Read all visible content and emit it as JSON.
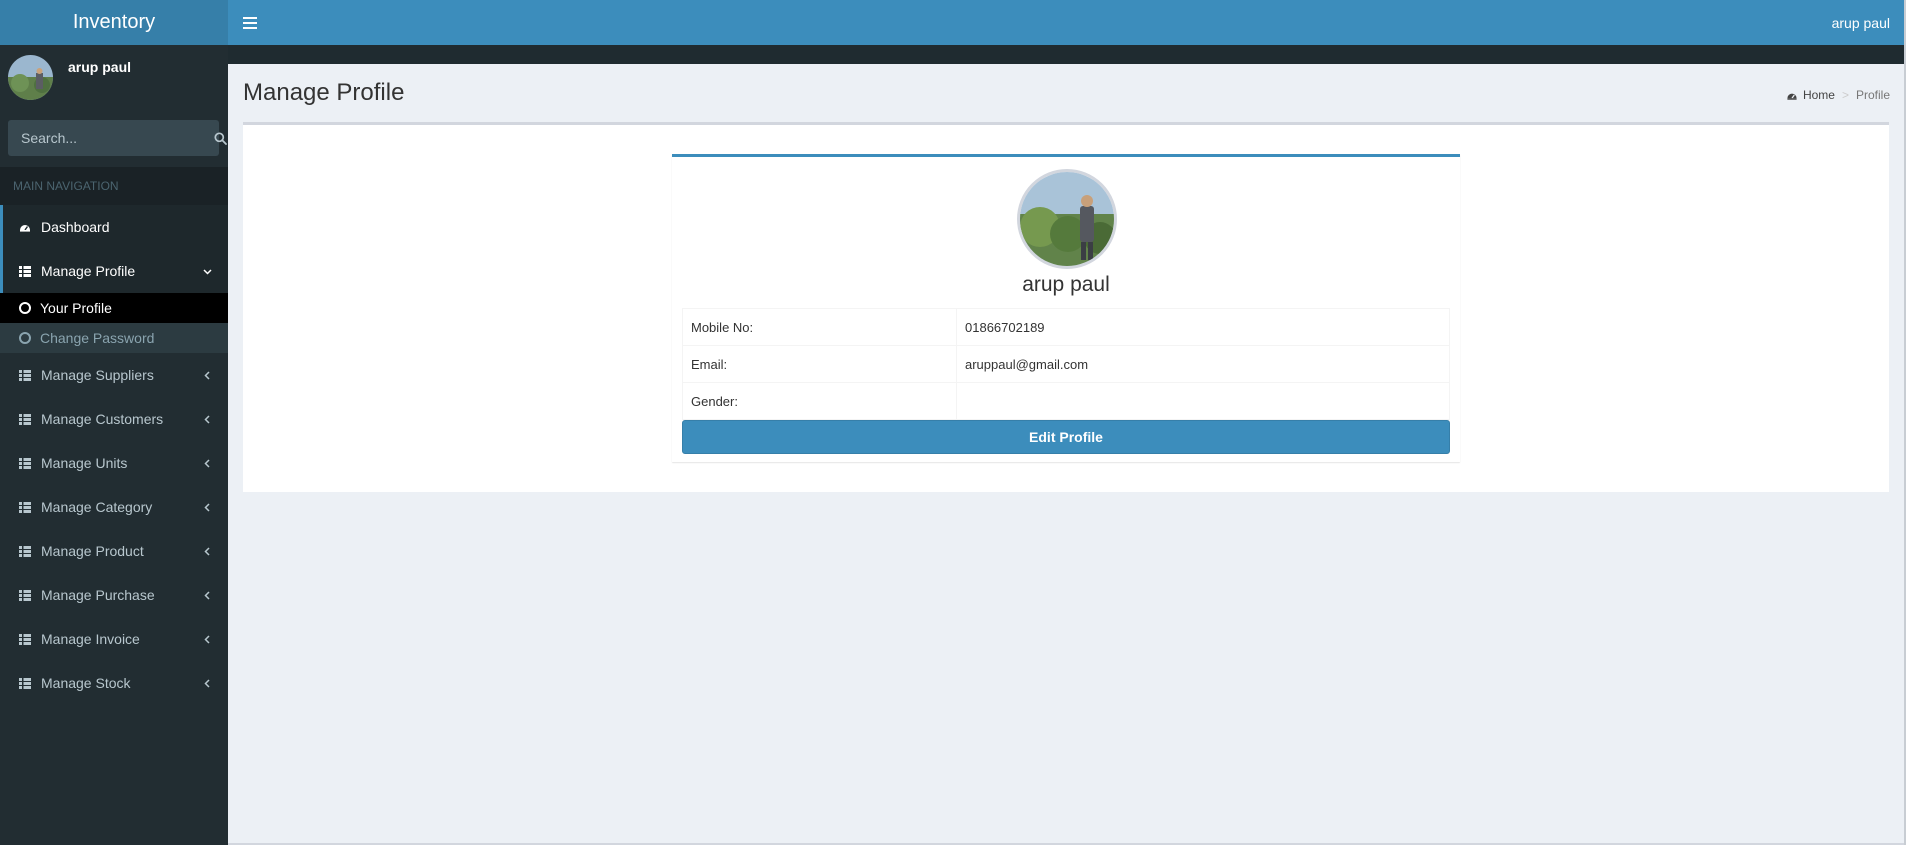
{
  "app": {
    "title": "Inventory"
  },
  "user": {
    "name": "arup paul"
  },
  "search": {
    "placeholder": "Search..."
  },
  "nav": {
    "header": "MAIN NAVIGATION",
    "dashboard": "Dashboard",
    "manage_profile": "Manage Profile",
    "profile_sub": [
      "Your Profile",
      "Change Password"
    ],
    "items": [
      "Manage Suppliers",
      "Manage Customers",
      "Manage Units",
      "Manage Category",
      "Manage Product",
      "Manage Purchase",
      "Manage Invoice",
      "Manage Stock"
    ]
  },
  "header": {
    "user": "arup paul"
  },
  "page": {
    "title": "Manage Profile"
  },
  "breadcrumb": {
    "home": "Home",
    "current": "Profile"
  },
  "profile": {
    "name": "arup paul",
    "rows": [
      {
        "label": "Mobile No:",
        "value": "01866702189"
      },
      {
        "label": "Email:",
        "value": "aruppaul@gmail.com"
      },
      {
        "label": "Gender:",
        "value": ""
      }
    ],
    "edit_label": "Edit Profile"
  },
  "colors": {
    "primary": "#3c8dbc",
    "sidebar": "#222d32",
    "background": "#ecf0f5"
  }
}
